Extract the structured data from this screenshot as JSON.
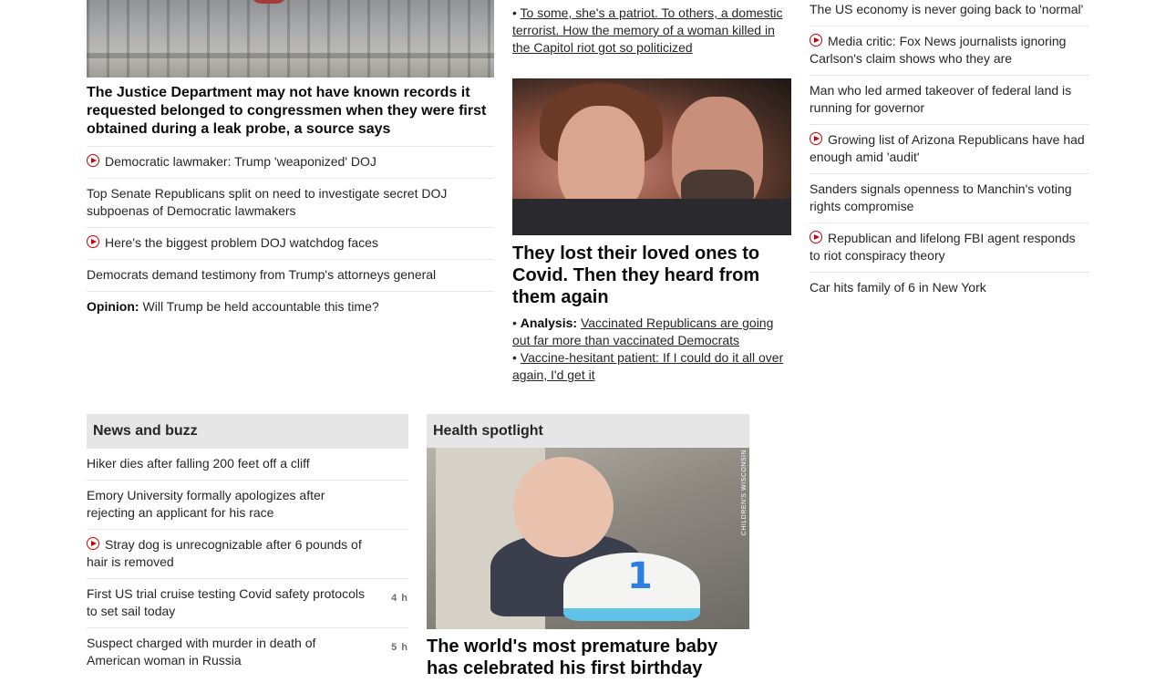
{
  "left_column": {
    "main_headline": "The Justice Department may not have known records it requested belonged to congressmen when they were first obtained during a leak probe, a source says",
    "items": [
      {
        "video": true,
        "label": "",
        "text": "Democratic lawmaker: Trump 'weaponized' DOJ"
      },
      {
        "video": false,
        "label": "",
        "text": "Top Senate Republicans split on need to investigate secret DOJ subpoenas of Democratic lawmakers"
      },
      {
        "video": true,
        "label": "",
        "text": "Here's the biggest problem DOJ watchdog faces"
      },
      {
        "video": false,
        "label": "",
        "text": "Democrats demand testimony from Trump's attorneys general"
      },
      {
        "video": false,
        "label": "Opinion:",
        "text": "Will Trump be held accountable this time?"
      }
    ]
  },
  "mid_column": {
    "top_link": "To some, she's a patriot. To others, a domestic terrorist. How the memory of a woman killed in the Capitol riot got so politicized",
    "headline": "They lost their loved ones to Covid. Then they heard from them again",
    "links": [
      {
        "label": "Analysis:",
        "text": "Vaccinated Republicans are going out far more than vaccinated Democrats"
      },
      {
        "label": "",
        "text": "Vaccine-hesitant patient: If I could do it all over again, I'd get it"
      }
    ]
  },
  "right_column": {
    "items": [
      {
        "video": false,
        "text": "The US economy is never going back to 'normal'"
      },
      {
        "video": true,
        "text": "Media critic: Fox News journalists ignoring Carlson's claim shows who they are"
      },
      {
        "video": false,
        "text": "Man who led armed takeover of federal land is running for governor"
      },
      {
        "video": true,
        "text": "Growing list of Arizona Republicans have had enough amid 'audit'"
      },
      {
        "video": false,
        "text": "Sanders signals openness to Manchin's voting rights compromise"
      },
      {
        "video": true,
        "text": "Republican and lifelong FBI agent responds to riot conspiracy theory"
      },
      {
        "video": false,
        "text": "Car hits family of 6 in New York"
      }
    ]
  },
  "news_and_buzz": {
    "title": "News and buzz",
    "items": [
      {
        "video": false,
        "text": "Hiker dies after falling 200 feet off a cliff",
        "time": ""
      },
      {
        "video": false,
        "text": "Emory University formally apologizes after rejecting an applicant for his race",
        "time": ""
      },
      {
        "video": true,
        "text": "Stray dog is unrecognizable after 6 pounds of hair is removed",
        "time": ""
      },
      {
        "video": false,
        "text": "First US trial cruise testing Covid safety protocols to set sail today",
        "time": "4 h"
      },
      {
        "video": false,
        "text": "Suspect charged with murder in death of American woman in Russia",
        "time": "5 h"
      }
    ]
  },
  "health_spotlight": {
    "title": "Health spotlight",
    "image_credit": "CHILDREN'S WISCONSIN",
    "cake_number": "1",
    "headline": "The world's most premature baby has celebrated his first birthday"
  },
  "colors": {
    "video_red": "#cc0000",
    "section_header_bg": "#e6e6e6",
    "divider": "#e6e6e6"
  }
}
